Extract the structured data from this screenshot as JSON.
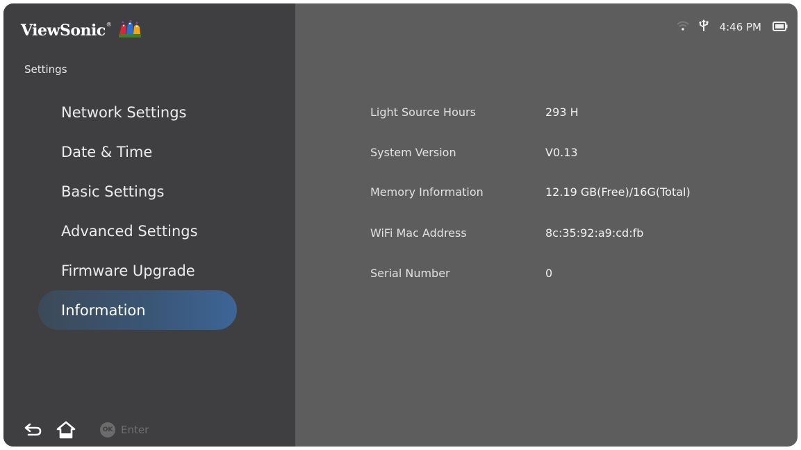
{
  "brand": {
    "name": "ViewSonic",
    "trademark": "®",
    "logo": "three-birds-logo"
  },
  "status_bar": {
    "wifi_icon": "wifi-icon",
    "usb_icon": "usb-icon",
    "time": "4:46 PM",
    "battery_icon": "battery-icon"
  },
  "sidebar": {
    "title": "Settings",
    "items": [
      {
        "label": "Network Settings",
        "selected": false
      },
      {
        "label": "Date & Time",
        "selected": false
      },
      {
        "label": "Basic Settings",
        "selected": false
      },
      {
        "label": "Advanced Settings",
        "selected": false
      },
      {
        "label": "Firmware Upgrade",
        "selected": false
      },
      {
        "label": "Information",
        "selected": true
      }
    ]
  },
  "bottom_bar": {
    "back_icon": "back-arrow-icon",
    "home_icon": "home-icon",
    "ok_badge": "OK",
    "enter_label": "Enter"
  },
  "information": {
    "rows": [
      {
        "label": "Light Source Hours",
        "value": "293 H"
      },
      {
        "label": "System Version",
        "value": "V0.13"
      },
      {
        "label": "Memory Information",
        "value": "12.19 GB(Free)/16G(Total)"
      },
      {
        "label": "WiFi Mac Address",
        "value": "8c:35:92:a9:cd:fb"
      },
      {
        "label": "Serial Number",
        "value": "0"
      }
    ]
  },
  "colors": {
    "sidebar_bg": "#3f3f41",
    "content_bg": "#5d5d5d",
    "selection_accent": "#3d6596"
  }
}
